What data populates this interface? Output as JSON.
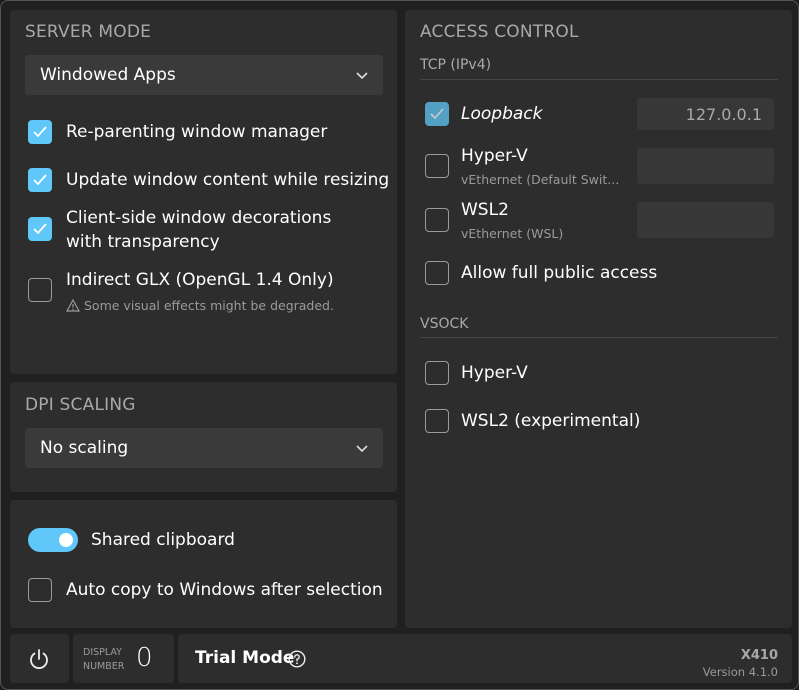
{
  "server_mode": {
    "title": "SERVER MODE",
    "dropdown_value": "Windowed Apps",
    "options": [
      {
        "label": "Re-parenting window manager",
        "checked": true
      },
      {
        "label": "Update window content while resizing",
        "checked": true
      },
      {
        "label_line1": "Client-side window decorations",
        "label_line2": "with transparency",
        "checked": true
      },
      {
        "label": "Indirect GLX (OpenGL 1.4 Only)",
        "checked": false,
        "warning": "Some visual effects might be degraded."
      }
    ]
  },
  "dpi_scaling": {
    "title": "DPI SCALING",
    "dropdown_value": "No scaling"
  },
  "clipboard": {
    "shared_label": "Shared clipboard",
    "shared_on": true,
    "autocopy_label": "Auto copy to Windows after selection",
    "autocopy_checked": false
  },
  "access_control": {
    "title": "ACCESS CONTROL",
    "tcp": {
      "heading": "TCP (IPv4)",
      "items": [
        {
          "label": "Loopback",
          "checked": true,
          "address": "127.0.0.1"
        },
        {
          "label": "Hyper-V",
          "sublabel": "vEthernet (Default Swit...",
          "checked": false,
          "address": ""
        },
        {
          "label": "WSL2",
          "sublabel": "vEthernet (WSL)",
          "checked": false,
          "address": ""
        }
      ],
      "public_label": "Allow full public access"
    },
    "vsock": {
      "heading": "VSOCK",
      "items": [
        {
          "label": "Hyper-V",
          "checked": false
        },
        {
          "label": "WSL2 (experimental)",
          "checked": false
        }
      ]
    }
  },
  "status_bar": {
    "display_label_line1": "DISPLAY",
    "display_label_line2": "NUMBER",
    "display_number": "0",
    "trial_label": "Trial Mode",
    "app_name": "X410",
    "version": "Version 4.1.0"
  },
  "colors": {
    "accent": "#5fc8f8",
    "panel": "#2d2d2d",
    "background": "#202020"
  }
}
